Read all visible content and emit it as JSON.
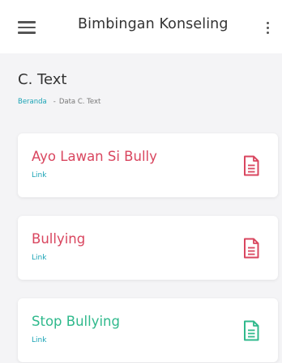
{
  "appbar": {
    "title": "Bimbingan Konseling",
    "menu_icon": "hamburger-menu-icon",
    "more_icon": "more-vertical-icon"
  },
  "page": {
    "title": "C. Text",
    "breadcrumb": {
      "home": "Beranda",
      "separator": "-",
      "current": "Data C. Text"
    }
  },
  "colors": {
    "red": "#d9465f",
    "green": "#2fb98c",
    "link": "#1aa3b5"
  },
  "cards": [
    {
      "title": "Ayo Lawan Si Bully",
      "link": "Link",
      "color": "#d9465f",
      "icon": "document-icon"
    },
    {
      "title": "Bullying",
      "link": "Link",
      "color": "#d9465f",
      "icon": "document-icon"
    },
    {
      "title": "Stop Bullying",
      "link": "Link",
      "color": "#2fb98c",
      "icon": "document-icon"
    }
  ]
}
